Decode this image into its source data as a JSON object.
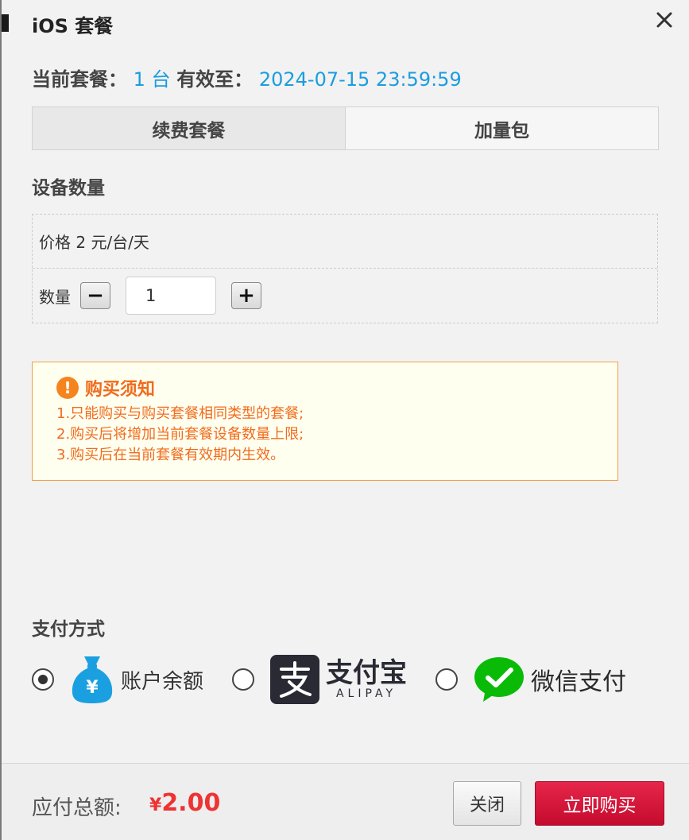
{
  "dialog": {
    "title": "iOS 套餐",
    "close_icon": "close-icon"
  },
  "current_plan": {
    "label": "当前套餐：",
    "count": "1 台",
    "expiry_label": "有效至：",
    "expiry_value": "2024-07-15 23:59:59"
  },
  "tabs": [
    {
      "label": "续费套餐",
      "active": true
    },
    {
      "label": "加量包",
      "active": false
    }
  ],
  "device": {
    "section_title": "设备数量",
    "price_text": "价格 2 元/台/天",
    "qty_label": "数量",
    "qty_value": "1",
    "minus_symbol": "−",
    "plus_symbol": "+"
  },
  "notice": {
    "title": "购买须知",
    "icon_symbol": "!",
    "lines": [
      "1.只能购买与购买套餐相同类型的套餐;",
      "2.购买后将增加当前套餐设备数量上限;",
      "3.购买后在当前套餐有效期内生效。"
    ]
  },
  "payment": {
    "section_title": "支付方式",
    "methods": [
      {
        "label": "账户余额",
        "icon": "money-bag-icon",
        "selected": true
      },
      {
        "label": "支付宝",
        "sublabel": "ALIPAY",
        "icon": "alipay-logo-icon",
        "selected": false
      },
      {
        "label": "微信支付",
        "icon": "wechat-pay-icon",
        "selected": false
      }
    ],
    "colors": {
      "balance": "#1aa0e0",
      "alipay": "#2a2a35",
      "wechat": "#09bb07"
    }
  },
  "footer": {
    "total_label": "应付总额:",
    "currency": "¥",
    "total_value": "2.00",
    "close_label": "关闭",
    "buy_label": "立即购买"
  }
}
